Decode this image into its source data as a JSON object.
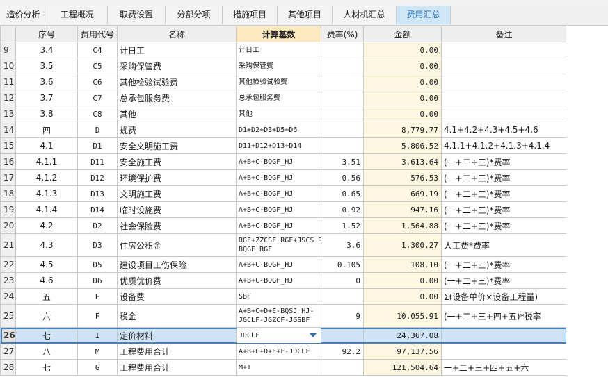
{
  "tabs": [
    {
      "label": "造价分析",
      "active": false
    },
    {
      "label": "工程概况",
      "active": false
    },
    {
      "label": "取费设置",
      "active": false
    },
    {
      "label": "分部分项",
      "active": false
    },
    {
      "label": "措施项目",
      "active": false
    },
    {
      "label": "其他项目",
      "active": false
    },
    {
      "label": "人材机汇总",
      "active": false
    },
    {
      "label": "费用汇总",
      "active": true
    }
  ],
  "columns": {
    "seq": "序号",
    "code": "费用代号",
    "name": "名称",
    "base": "计算基数",
    "rate": "费率(%)",
    "amount": "金额",
    "note": "备注"
  },
  "rows": [
    {
      "rn": "9",
      "seq": "3.4",
      "code": "C4",
      "name": "计日工",
      "base": "计日工",
      "rate": "",
      "amount": "0.00",
      "note": ""
    },
    {
      "rn": "10",
      "seq": "3.5",
      "code": "C5",
      "name": "采购保管费",
      "base": "采购保管费",
      "rate": "",
      "amount": "0.00",
      "note": ""
    },
    {
      "rn": "11",
      "seq": "3.6",
      "code": "C6",
      "name": "其他检验试验费",
      "base": "其他检验试验费",
      "rate": "",
      "amount": "0.00",
      "note": ""
    },
    {
      "rn": "12",
      "seq": "3.7",
      "code": "C7",
      "name": "总承包服务费",
      "base": "总承包服务费",
      "rate": "",
      "amount": "0.00",
      "note": ""
    },
    {
      "rn": "13",
      "seq": "3.8",
      "code": "C8",
      "name": "其他",
      "base": "其他",
      "rate": "",
      "amount": "0.00",
      "note": ""
    },
    {
      "rn": "14",
      "seq": "四",
      "code": "D",
      "name": "规费",
      "base": "D1+D2+D3+D5+D6",
      "rate": "",
      "amount": "8,779.77",
      "note": "4.1+4.2+4.3+4.5+4.6"
    },
    {
      "rn": "15",
      "seq": "4.1",
      "code": "D1",
      "name": "安全文明施工费",
      "base": "D11+D12+D13+D14",
      "rate": "",
      "amount": "5,806.52",
      "note": "4.1.1+4.1.2+4.1.3+4.1.4"
    },
    {
      "rn": "16",
      "seq": "4.1.1",
      "code": "D11",
      "name": "安全施工费",
      "base": "A+B+C-BQGF_HJ",
      "rate": "3.51",
      "amount": "3,613.64",
      "note": "(一+二+三)*费率"
    },
    {
      "rn": "17",
      "seq": "4.1.2",
      "code": "D12",
      "name": "环境保护费",
      "base": "A+B+C-BQGF_HJ",
      "rate": "0.56",
      "amount": "576.53",
      "note": "(一+二+三)*费率"
    },
    {
      "rn": "18",
      "seq": "4.1.3",
      "code": "D13",
      "name": "文明施工费",
      "base": "A+B+C-BQGF_HJ",
      "rate": "0.65",
      "amount": "669.19",
      "note": "(一+二+三)*费率"
    },
    {
      "rn": "19",
      "seq": "4.1.4",
      "code": "D14",
      "name": "临时设施费",
      "base": "A+B+C-BQGF_HJ",
      "rate": "0.92",
      "amount": "947.16",
      "note": "(一+二+三)*费率"
    },
    {
      "rn": "20",
      "seq": "4.2",
      "code": "D2",
      "name": "社会保险费",
      "base": "A+B+C-BQGF_HJ",
      "rate": "1.52",
      "amount": "1,564.88",
      "note": "(一+二+三)*费率"
    },
    {
      "rn": "21",
      "seq": "4.3",
      "code": "D3",
      "name": "住房公积金",
      "base": "RGF+ZZCSF_RGF+JSCS_RGF-BQGF_RGF",
      "rate": "3.6",
      "amount": "1,300.27",
      "note": "人工费*费率",
      "tall": true
    },
    {
      "rn": "22",
      "seq": "4.5",
      "code": "D5",
      "name": "建设项目工伤保险",
      "base": "A+B+C-BQGF_HJ",
      "rate": "0.105",
      "amount": "108.10",
      "note": "(一+二+三)*费率"
    },
    {
      "rn": "23",
      "seq": "4.6",
      "code": "D6",
      "name": "优质优价费",
      "base": "A+B+C-BQGF_HJ",
      "rate": "0",
      "amount": "0.00",
      "note": "(一+二+三)*费率"
    },
    {
      "rn": "24",
      "seq": "五",
      "code": "E",
      "name": "设备费",
      "base": "SBF",
      "rate": "",
      "amount": "0.00",
      "note": "Σ(设备单价×设备工程量)"
    },
    {
      "rn": "25",
      "seq": "六",
      "code": "F",
      "name": "税金",
      "base": "A+B+C+D+E-BQSJ_HJ-JGCLF-JGZCF-JGSBF",
      "rate": "9",
      "amount": "10,055.91",
      "note": "(一+二+三+四+五)*税率",
      "tall": true
    },
    {
      "rn": "26",
      "seq": "七",
      "code": "I",
      "name": "定价材料",
      "base": "JDCLF",
      "rate": "",
      "amount": "24,367.08",
      "note": "",
      "selected": true
    },
    {
      "rn": "27",
      "seq": "八",
      "code": "M",
      "name": "工程费用合计",
      "base": "A+B+C+D+E+F-JDCLF",
      "rate": "92.2",
      "amount": "97,137.56",
      "note": ""
    },
    {
      "rn": "28",
      "seq": "七",
      "code": "G",
      "name": "工程费用合计",
      "base": "M+I",
      "rate": "",
      "amount": "121,504.64",
      "note": "一+二+三+四+五+六"
    }
  ]
}
